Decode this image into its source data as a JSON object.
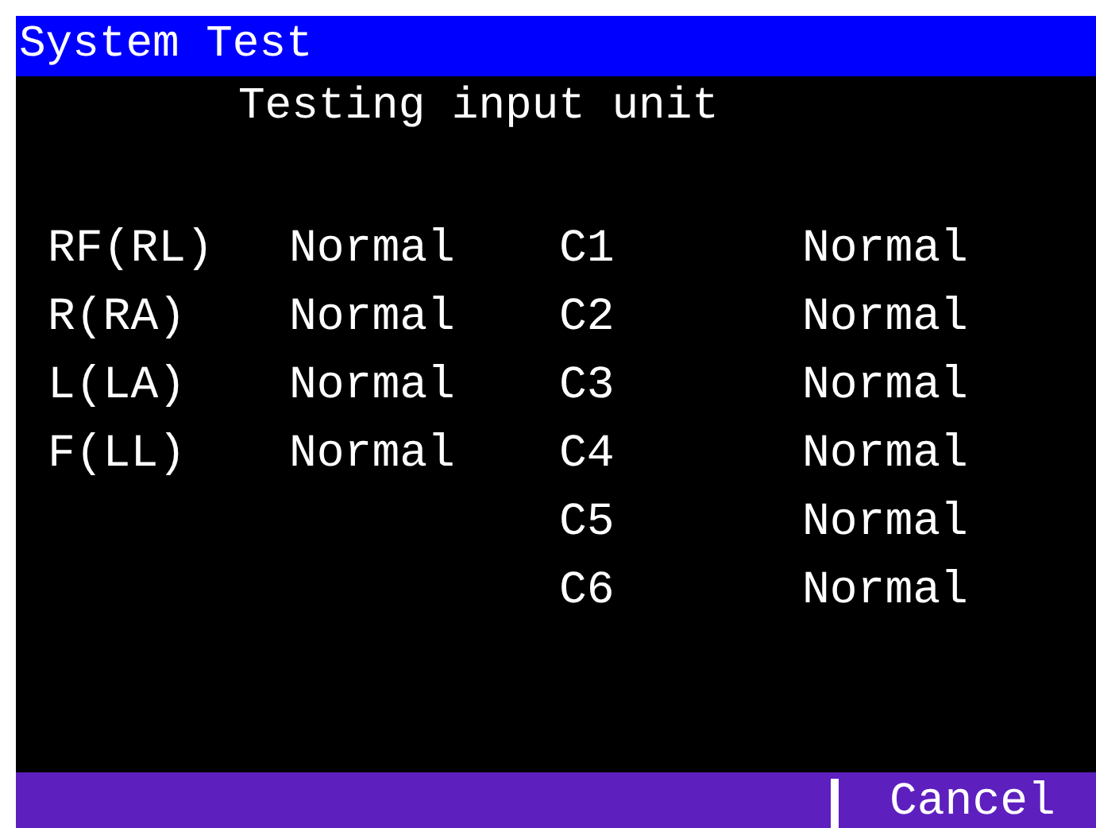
{
  "window": {
    "title": "System Test"
  },
  "subtitle": "Testing input unit",
  "limb_leads": [
    {
      "lead": "RF(RL)",
      "status": "Normal"
    },
    {
      "lead": "R(RA)",
      "status": "Normal"
    },
    {
      "lead": "L(LA)",
      "status": "Normal"
    },
    {
      "lead": "F(LL)",
      "status": "Normal"
    }
  ],
  "chest_leads": [
    {
      "lead": "C1",
      "status": "Normal"
    },
    {
      "lead": "C2",
      "status": "Normal"
    },
    {
      "lead": "C3",
      "status": "Normal"
    },
    {
      "lead": "C4",
      "status": "Normal"
    },
    {
      "lead": "C5",
      "status": "Normal"
    },
    {
      "lead": "C6",
      "status": "Normal"
    }
  ],
  "button": "Cancel"
}
